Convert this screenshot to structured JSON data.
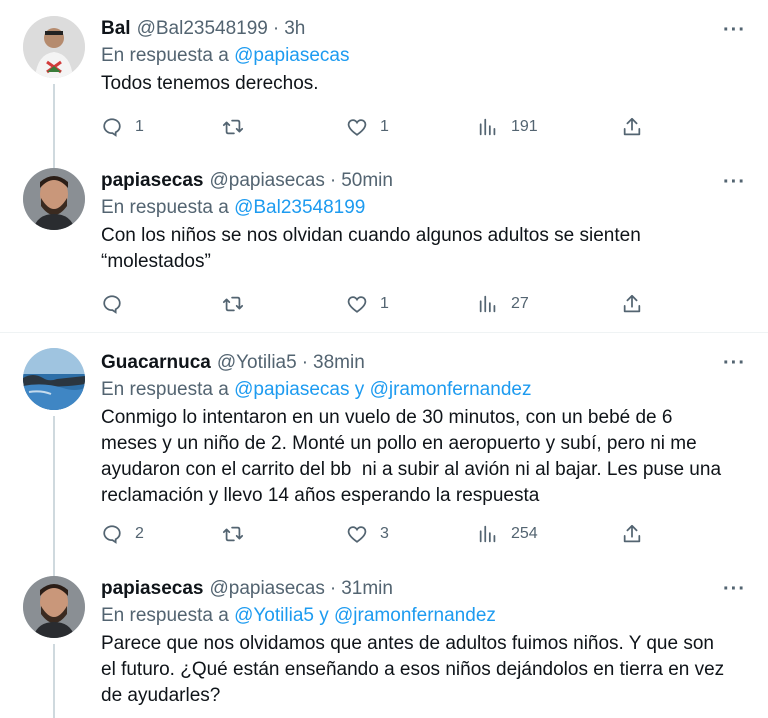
{
  "tweets": [
    {
      "name": "Bal",
      "handle": "@Bal23548199",
      "time": "3h",
      "reply_prefix": "En respuesta a",
      "mention1": "@papiasecas",
      "joiner": "",
      "mention2": "",
      "text": "Todos tenemos derechos.",
      "replies": "1",
      "retweets": "",
      "likes": "1",
      "views": "191"
    },
    {
      "name": "papiasecas",
      "handle": "@papiasecas",
      "time": "50min",
      "reply_prefix": "En respuesta a",
      "mention1": "@Bal23548199",
      "joiner": "",
      "mention2": "",
      "text": "Con los niños se nos olvidan cuando algunos adultos se sienten\n“molestados”",
      "replies": "",
      "retweets": "",
      "likes": "1",
      "views": "27"
    },
    {
      "name": "Guacarnuca",
      "handle": "@Yotilia5",
      "time": "38min",
      "reply_prefix": "En respuesta a",
      "mention1": "@papiasecas",
      "joiner": "y",
      "mention2": "@jramonfernandez",
      "text": "Conmigo lo intentaron en un vuelo de 30 minutos, con un bebé de 6\nmeses y un niño de 2. Monté un pollo en aeropuerto y subí, pero ni me\nayudaron con el carrito del bb  ni a subir al avión ni al bajar. Les puse una\nreclamación y llevo 14 años esperando la respuesta",
      "replies": "2",
      "retweets": "",
      "likes": "3",
      "views": "254"
    },
    {
      "name": "papiasecas",
      "handle": "@papiasecas",
      "time": "31min",
      "reply_prefix": "En respuesta a",
      "mention1": "@Yotilia5",
      "joiner": "y",
      "mention2": "@jramonfernandez",
      "text": "Parece que nos olvidamos que antes de adultos fuimos niños. Y que son\nel futuro. ¿Qué están enseñando a esos niños dejándolos en tierra en vez\nde ayudarles?",
      "replies": "",
      "retweets": "",
      "likes": "",
      "views": ""
    }
  ],
  "header_separator": "·",
  "more_label": "···",
  "colors": {
    "link": "#1d9bf0",
    "secondary_text": "#536471",
    "primary_text": "#0f1419",
    "thread_line": "#cfd9de",
    "divider": "#eff3f4"
  },
  "icons": [
    "reply-icon",
    "retweet-icon",
    "like-icon",
    "views-icon",
    "share-icon",
    "more-icon"
  ]
}
